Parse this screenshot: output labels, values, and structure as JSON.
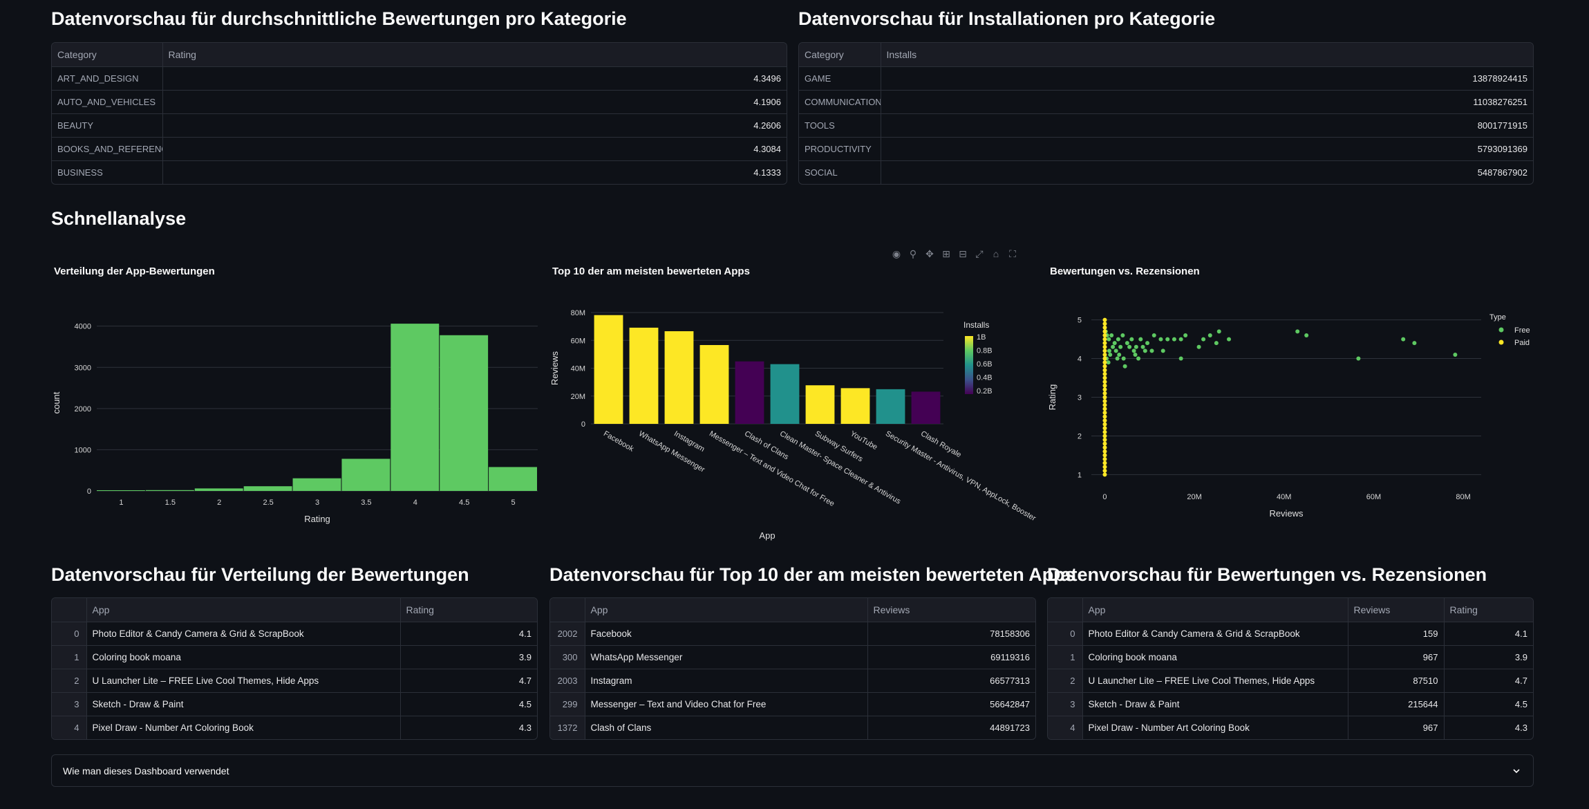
{
  "top_left": {
    "title": "Datenvorschau für durchschnittliche Bewertungen pro Kategorie",
    "columns": [
      "Category",
      "Rating"
    ],
    "rows": [
      [
        "ART_AND_DESIGN",
        "4.3496"
      ],
      [
        "AUTO_AND_VEHICLES",
        "4.1906"
      ],
      [
        "BEAUTY",
        "4.2606"
      ],
      [
        "BOOKS_AND_REFERENCE",
        "4.3084"
      ],
      [
        "BUSINESS",
        "4.1333"
      ]
    ]
  },
  "top_right": {
    "title": "Datenvorschau für Installationen pro Kategorie",
    "columns": [
      "Category",
      "Installs"
    ],
    "rows": [
      [
        "GAME",
        "13878924415"
      ],
      [
        "COMMUNICATION",
        "11038276251"
      ],
      [
        "TOOLS",
        "8001771915"
      ],
      [
        "PRODUCTIVITY",
        "5793091369"
      ],
      [
        "SOCIAL",
        "5487867902"
      ]
    ]
  },
  "quick": {
    "title": "Schnellanalyse"
  },
  "toolbar": {
    "icons": [
      "camera-icon",
      "zoom-icon",
      "pan-icon",
      "zoom-in-icon",
      "zoom-out-icon",
      "autoscale-icon",
      "reset-icon",
      "fullscreen-icon"
    ]
  },
  "chart_data": [
    {
      "type": "bar",
      "title": "Verteilung der App-Bewertungen",
      "xlabel": "Rating",
      "ylabel": "count",
      "x_ticks": [
        "1",
        "1.5",
        "2",
        "2.5",
        "3",
        "3.5",
        "4",
        "4.5",
        "5"
      ],
      "y_ticks": [
        "0",
        "1000",
        "2000",
        "3000",
        "4000"
      ],
      "bins": [
        {
          "x0": 0.75,
          "x1": 1.25,
          "count": 17
        },
        {
          "x0": 1.25,
          "x1": 1.75,
          "count": 20
        },
        {
          "x0": 1.75,
          "x1": 2.25,
          "count": 61
        },
        {
          "x0": 2.25,
          "x1": 2.75,
          "count": 114
        },
        {
          "x0": 2.75,
          "x1": 3.25,
          "count": 307
        },
        {
          "x0": 3.25,
          "x1": 3.75,
          "count": 780
        },
        {
          "x0": 3.75,
          "x1": 4.25,
          "count": 4060
        },
        {
          "x0": 4.25,
          "x1": 4.75,
          "count": 3780
        },
        {
          "x0": 4.75,
          "x1": 5.25,
          "count": 580
        }
      ],
      "xlim": [
        0.75,
        5.25
      ],
      "ylim": [
        0,
        4280
      ],
      "color": "#5ec962",
      "grid": true
    },
    {
      "type": "bar",
      "title": "Top 10 der am meisten bewerteten Apps",
      "xlabel": "App",
      "ylabel": "Reviews",
      "categories": [
        "Facebook",
        "WhatsApp Messenger",
        "Instagram",
        "Messenger – Text and Video Chat for Free",
        "Clash of Clans",
        "Clean Master- Space Cleaner & Antivirus",
        "Subway Surfers",
        "YouTube",
        "Security Master - Antivirus, VPN, AppLock, Booster",
        "Clash Royale"
      ],
      "values": [
        78158306,
        69119316,
        66577313,
        56642847,
        44891723,
        42916526,
        27722264,
        25655305,
        24900999,
        23133508
      ],
      "colors": [
        "#fde725",
        "#fde725",
        "#fde725",
        "#fde725",
        "#440154",
        "#21918c",
        "#fde725",
        "#fde725",
        "#21918c",
        "#440154"
      ],
      "y_ticks": [
        "0",
        "20M",
        "40M",
        "60M",
        "80M"
      ],
      "ylim": [
        0,
        80000000
      ],
      "colorbar": {
        "title": "Installs",
        "ticks": [
          "1B",
          "0.8B",
          "0.6B",
          "0.4B",
          "0.2B"
        ]
      },
      "grid": true
    },
    {
      "type": "scatter",
      "title": "Bewertungen vs. Rezensionen",
      "xlabel": "Reviews",
      "ylabel": "Rating",
      "x_ticks": [
        "0",
        "20M",
        "40M",
        "60M",
        "80M"
      ],
      "y_ticks": [
        "1",
        "2",
        "3",
        "4",
        "5"
      ],
      "xlim": [
        -3000000,
        84000000
      ],
      "ylim": [
        0.9,
        5.1
      ],
      "legend": {
        "title": "Type",
        "placement": "top-right"
      },
      "series": [
        {
          "name": "Free",
          "color": "#5ec962",
          "points": [
            [
              200000,
              4.7
            ],
            [
              500000,
              4.6
            ],
            [
              900000,
              4.5
            ],
            [
              1500000,
              4.6
            ],
            [
              2200000,
              4.4
            ],
            [
              3000000,
              4.5
            ],
            [
              4000000,
              4.6
            ],
            [
              5000000,
              4.4
            ],
            [
              6000000,
              4.5
            ],
            [
              7000000,
              4.3
            ],
            [
              8000000,
              4.5
            ],
            [
              9500000,
              4.4
            ],
            [
              11000000,
              4.6
            ],
            [
              12500000,
              4.5
            ],
            [
              14000000,
              4.5
            ],
            [
              15500000,
              4.5
            ],
            [
              17000000,
              4.5
            ],
            [
              18000000,
              4.6
            ],
            [
              21000000,
              4.3
            ],
            [
              22000000,
              4.5
            ],
            [
              23500000,
              4.6
            ],
            [
              25500000,
              4.7
            ],
            [
              27700000,
              4.5
            ],
            [
              43000000,
              4.7
            ],
            [
              45000000,
              4.6
            ],
            [
              56600000,
              4.0
            ],
            [
              66600000,
              4.5
            ],
            [
              69100000,
              4.4
            ],
            [
              78200000,
              4.1
            ],
            [
              1000000,
              4.2
            ],
            [
              2500000,
              4.2
            ],
            [
              4500000,
              3.8
            ],
            [
              6500000,
              4.2
            ],
            [
              9000000,
              4.2
            ],
            [
              13000000,
              4.2
            ],
            [
              17000000,
              4.0
            ],
            [
              24900000,
              4.4
            ],
            [
              3500000,
              4.3
            ],
            [
              5500000,
              4.3
            ],
            [
              8500000,
              4.3
            ],
            [
              10500000,
              4.2
            ],
            [
              400000,
              4.0
            ],
            [
              800000,
              3.9
            ],
            [
              1200000,
              4.1
            ],
            [
              1800000,
              4.3
            ],
            [
              2800000,
              4.0
            ],
            [
              3200000,
              4.1
            ],
            [
              4200000,
              4.0
            ],
            [
              6800000,
              4.1
            ],
            [
              7500000,
              4.0
            ]
          ]
        },
        {
          "name": "Paid",
          "color": "#fde725",
          "points": [
            [
              0,
              5.0
            ],
            [
              0,
              4.9
            ],
            [
              0,
              4.8
            ],
            [
              0,
              4.7
            ],
            [
              0,
              4.6
            ],
            [
              0,
              4.5
            ],
            [
              0,
              4.4
            ],
            [
              0,
              4.3
            ],
            [
              0,
              4.2
            ],
            [
              0,
              4.1
            ],
            [
              0,
              4.0
            ],
            [
              0,
              3.9
            ],
            [
              0,
              3.8
            ],
            [
              0,
              3.7
            ],
            [
              0,
              3.6
            ],
            [
              0,
              3.5
            ],
            [
              0,
              3.4
            ],
            [
              0,
              3.3
            ],
            [
              0,
              3.2
            ],
            [
              0,
              3.1
            ],
            [
              0,
              3.0
            ],
            [
              0,
              2.9
            ],
            [
              0,
              2.8
            ],
            [
              0,
              2.7
            ],
            [
              0,
              2.6
            ],
            [
              0,
              2.5
            ],
            [
              0,
              2.4
            ],
            [
              0,
              2.3
            ],
            [
              0,
              2.2
            ],
            [
              0,
              2.1
            ],
            [
              0,
              2.0
            ],
            [
              0,
              1.9
            ],
            [
              0,
              1.8
            ],
            [
              0,
              1.7
            ],
            [
              0,
              1.6
            ],
            [
              0,
              1.5
            ],
            [
              0,
              1.4
            ],
            [
              0,
              1.3
            ],
            [
              0,
              1.2
            ],
            [
              0,
              1.1
            ],
            [
              0,
              1.0
            ]
          ]
        }
      ],
      "grid": true
    }
  ],
  "preview_ratings": {
    "title": "Datenvorschau für Verteilung der Bewertungen",
    "columns": [
      "",
      "App",
      "Rating"
    ],
    "rows": [
      [
        "0",
        "Photo Editor & Candy Camera & Grid & ScrapBook",
        "4.1"
      ],
      [
        "1",
        "Coloring book moana",
        "3.9"
      ],
      [
        "2",
        "U Launcher Lite – FREE Live Cool Themes, Hide Apps",
        "4.7"
      ],
      [
        "3",
        "Sketch - Draw & Paint",
        "4.5"
      ],
      [
        "4",
        "Pixel Draw - Number Art Coloring Book",
        "4.3"
      ]
    ]
  },
  "preview_top10": {
    "title": "Datenvorschau für Top 10 der am meisten bewerteten Apps",
    "columns": [
      "",
      "App",
      "Reviews"
    ],
    "rows": [
      [
        "2002",
        "Facebook",
        "78158306"
      ],
      [
        "300",
        "WhatsApp Messenger",
        "69119316"
      ],
      [
        "2003",
        "Instagram",
        "66577313"
      ],
      [
        "299",
        "Messenger – Text and Video Chat for Free",
        "56642847"
      ],
      [
        "1372",
        "Clash of Clans",
        "44891723"
      ]
    ]
  },
  "preview_scatter": {
    "title": "Datenvorschau für Bewertungen vs. Rezensionen",
    "columns": [
      "",
      "App",
      "Reviews",
      "Rating"
    ],
    "rows": [
      [
        "0",
        "Photo Editor & Candy Camera & Grid & ScrapBook",
        "159",
        "4.1"
      ],
      [
        "1",
        "Coloring book moana",
        "967",
        "3.9"
      ],
      [
        "2",
        "U Launcher Lite – FREE Live Cool Themes, Hide Apps",
        "87510",
        "4.7"
      ],
      [
        "3",
        "Sketch - Draw & Paint",
        "215644",
        "4.5"
      ],
      [
        "4",
        "Pixel Draw - Number Art Coloring Book",
        "967",
        "4.3"
      ]
    ]
  },
  "expander": {
    "label": "Wie man dieses Dashboard verwendet"
  }
}
